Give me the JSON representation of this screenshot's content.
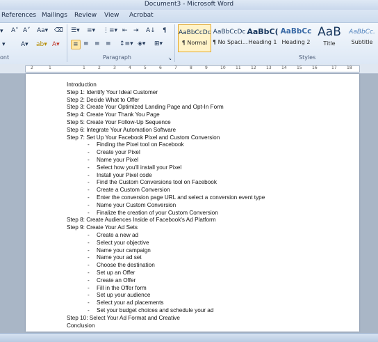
{
  "window": {
    "title": "Document3 - Microsoft Word"
  },
  "tabs": [
    "References",
    "Mailings",
    "Review",
    "View",
    "Acrobat"
  ],
  "ribbon": {
    "groups": {
      "font": "ont",
      "paragraph": "Paragraph",
      "styles": "Styles"
    },
    "styles": [
      {
        "preview": "AaBbCcDc",
        "name": "¶ Normal",
        "selected": true
      },
      {
        "preview": "AaBbCcDc",
        "name": "¶ No Spaci..."
      },
      {
        "preview": "AaBbC(",
        "name": "Heading 1"
      },
      {
        "preview": "AaBbCc",
        "name": "Heading 2"
      },
      {
        "preview": "AaB",
        "name": "Title"
      },
      {
        "preview": "AaBbCc.",
        "name": "Subtitle"
      }
    ]
  },
  "ruler": {
    "numbers": [
      "2",
      "1",
      "1",
      "2",
      "3",
      "4",
      "5",
      "6",
      "7",
      "8",
      "9",
      "10",
      "11",
      "12",
      "13",
      "14",
      "15",
      "16",
      "17",
      "18"
    ]
  },
  "document": {
    "lines": [
      {
        "text": "Introduction"
      },
      {
        "text": "Step 1: Identify Your Ideal Customer"
      },
      {
        "text": "Step 2: Decide What to Offer"
      },
      {
        "text": "Step 3: Create Your Optimized Landing Page and Opt-In Form"
      },
      {
        "text": "Step 4: Create Your Thank You Page"
      },
      {
        "text": "Step 5: Create Your Follow-Up Sequence"
      },
      {
        "text": "Step 6: Integrate Your Automation Software"
      },
      {
        "text": "Step 7: Set Up Your Facebook Pixel and Custom Conversion"
      },
      {
        "text": "Finding the Pixel tool on Facebook",
        "sub": true
      },
      {
        "text": "Create your Pixel",
        "sub": true
      },
      {
        "text": "Name your Pixel",
        "sub": true
      },
      {
        "text": "Select how you'll install your Pixel",
        "sub": true
      },
      {
        "text": "Install your Pixel code",
        "sub": true
      },
      {
        "text": "Find the Custom Conversions tool on Facebook",
        "sub": true
      },
      {
        "text": "Create a Custom Conversion",
        "sub": true
      },
      {
        "text": "Enter the conversion page URL and select a conversion event type",
        "sub": true
      },
      {
        "text": "Name your Custom Conversion",
        "sub": true
      },
      {
        "text": "Finalize the creation of your Custom Conversion",
        "sub": true
      },
      {
        "text": "Step 8: Create Audiences Inside of Facebook's Ad Platform"
      },
      {
        "text": "Step 9: Create Your Ad Sets"
      },
      {
        "text": "Create a new ad",
        "sub": true
      },
      {
        "text": "Select your objective",
        "sub": true
      },
      {
        "text": "Name your campaign",
        "sub": true
      },
      {
        "text": "Name your ad set",
        "sub": true
      },
      {
        "text": "Choose the destination",
        "sub": true
      },
      {
        "text": "Set up an Offer",
        "sub": true
      },
      {
        "text": "Create an Offer",
        "sub": true
      },
      {
        "text": "Fill in the Offer form",
        "sub": true
      },
      {
        "text": "Set up your audience",
        "sub": true
      },
      {
        "text": "Select your ad placements",
        "sub": true
      },
      {
        "text": "Set your budget choices and schedule your ad",
        "sub": true
      },
      {
        "text": "Step 10: Select Your Ad Format and Creative"
      },
      {
        "text": "Conclusion"
      }
    ]
  }
}
